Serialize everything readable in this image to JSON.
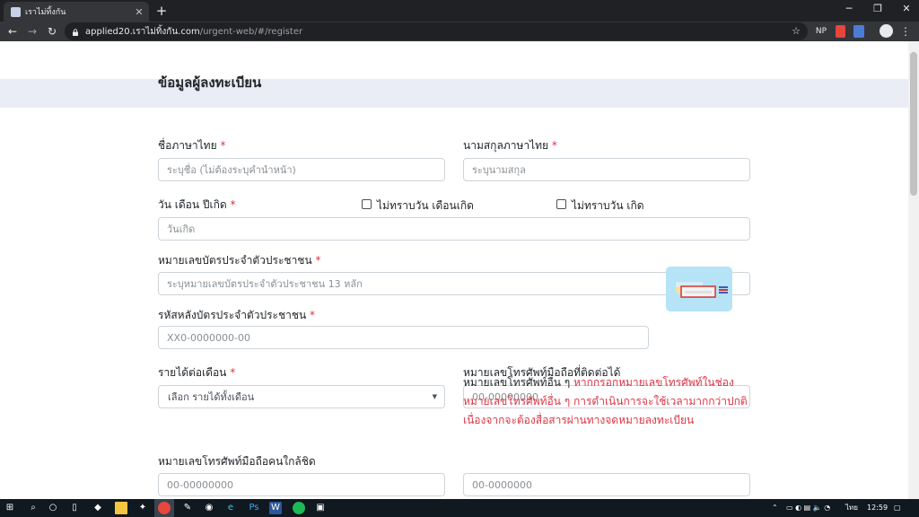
{
  "browser": {
    "tab_title": "เราไม่ทิ้งกัน",
    "tab_close": "✕",
    "new_tab": "+",
    "url_host": "applied20.เราไม่ทิ้งกัน.com",
    "url_path": "/urgent-web/#/register",
    "extension_np": "NP"
  },
  "form": {
    "title": "ข้อมูลผู้ลงทะเบียน",
    "required_mark": "*",
    "first_name": {
      "label": "ชื่อภาษาไทย",
      "placeholder": "ระบุชื่อ (ไม่ต้องระบุคำนำหน้า)"
    },
    "last_name": {
      "label": "นามสกุลภาษาไทย",
      "placeholder": "ระบุนามสกุล"
    },
    "birthdate": {
      "label": "วัน เดือน ปีเกิด",
      "placeholder": "วันเกิด"
    },
    "unknown_day_month": {
      "label": "ไม่ทราบวัน เดือนเกิด"
    },
    "unknown_day": {
      "label": "ไม่ทราบวัน เกิด"
    },
    "id_card": {
      "label": "หมายเลขบัตรประจำตัวประชาชน",
      "placeholder": "ระบุหมายเลขบัตรประจำตัวประชาชน 13 หลัก"
    },
    "laser_code": {
      "label": "รหัสหลังบัตรประจำตัวประชาชน",
      "placeholder": "XX0-0000000-00"
    },
    "income": {
      "label": "รายได้ต่อเดือน",
      "selected": "เลือก รายได้ทั้งเดือน"
    },
    "mobile": {
      "label": "หมายเลขโทรศัพท์มือถือที่ติดต่อได้",
      "placeholder": "00-00000000"
    },
    "close_person_mobile": {
      "label": "หมายเลขโทรศัพท์มือถือคนใกล้ชิด",
      "placeholder": "00-00000000"
    },
    "other_phone": {
      "label": "หมายเลขโทรศัพท์อื่น ๆ",
      "note": "หากกรอกหมายเลขโทรศัพท์ในช่องหมายเลขโทรศัพท์อื่น ๆ การดำเนินการจะใช้เวลามากกว่าปกติ เนื่องจากจะต้องสื่อสารผ่านทางจดหมายลงทะเบียน",
      "placeholder": "00-0000000"
    }
  },
  "taskbar": {
    "lang": "ไทย",
    "time": "12:59"
  },
  "colors": {
    "required": "#dc3545",
    "banner": "#eaedf5",
    "chrome_dark": "#202124"
  }
}
